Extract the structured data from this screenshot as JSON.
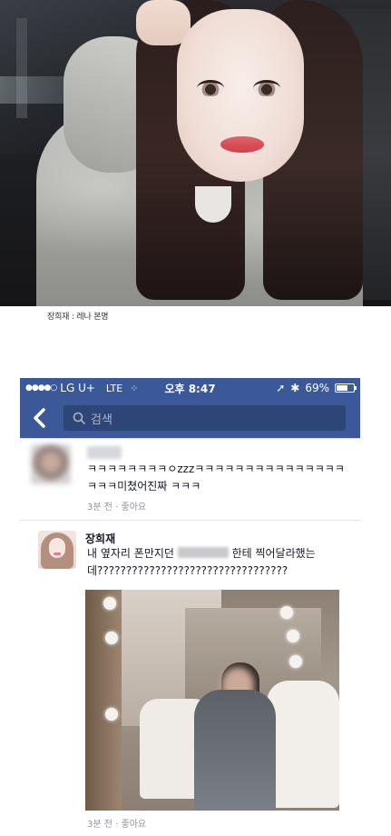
{
  "caption": "장희재 : 레나 본명",
  "status_bar": {
    "signal": "●●●●○",
    "carrier": "LG U+",
    "network": "LTE",
    "loading": "⁘",
    "time": "오후 8:47",
    "location_arrow": "➚",
    "bluetooth": "✱",
    "battery_percent": "69%",
    "battery_level": 0.69
  },
  "nav": {
    "back": "<",
    "search_placeholder": "검색"
  },
  "comments": [
    {
      "text": "ㅋㅋㅋㅋㅋㅋㅋㅋㅇzzzㅋㅋㅋㅋㅋㅋㅋㅋㅋㅋㅋㅋㅋㅋㅋㅋㅋㅋ미쳤어진짜 ㅋㅋㅋ",
      "time": "3분 전",
      "like": "좋아요"
    },
    {
      "author": "장희재",
      "text_before": "내 옆자리 폰만지던 ",
      "text_after": " 한테 찍어달라했는데?????????????????????????????????",
      "time": "3분 전",
      "like": "좋아요"
    }
  ],
  "colors": {
    "facebook_blue": "#3b5998",
    "search_bg": "#2d4577",
    "meta_gray": "#90949c"
  }
}
